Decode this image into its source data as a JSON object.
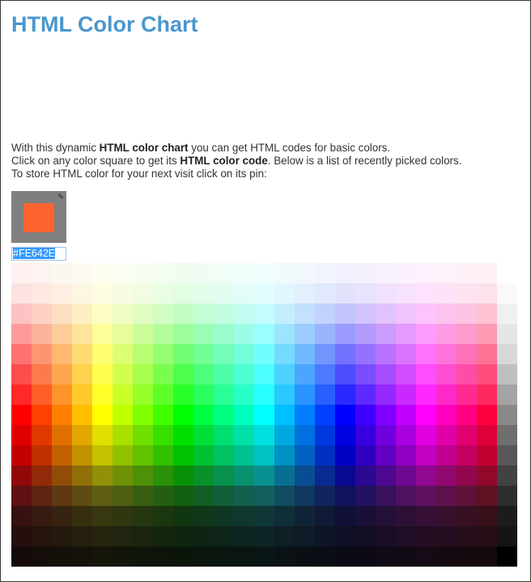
{
  "page": {
    "title": "HTML Color Chart",
    "intro": {
      "line1_pre": "With this dynamic ",
      "line1_bold": "HTML color chart",
      "line1_post": " you can get HTML codes for basic colors.",
      "line2_pre": "Click on any color square to get its ",
      "line2_bold": "HTML color code",
      "line2_post": ". Below is a list of recently picked colors.",
      "line3": "To store HTML color for your next visit click on its pin:"
    }
  },
  "picked": {
    "color": "#FE642E",
    "hex_value": "#FE642E",
    "pin_icon": "pin-icon",
    "background": "#7f7f7f"
  },
  "chart_data": {
    "type": "table",
    "hue_steps": 24,
    "gray_column": [
      "#ffffff",
      "#f9f9f9",
      "#f0f0f0",
      "#e6e6e6",
      "#d8d8d8",
      "#bfbfbf",
      "#a4a4a4",
      "#8a8a8a",
      "#6f6f6f",
      "#585858",
      "#424242",
      "#2e2e2e",
      "#1c1c1c",
      "#151515",
      "#000000"
    ],
    "lightness_rows": [
      0.97,
      0.94,
      0.88,
      0.8,
      0.72,
      0.65,
      0.58,
      0.5,
      0.44,
      0.38,
      0.3,
      0.22,
      0.14,
      0.1,
      0.06
    ],
    "saturation_rows": [
      0.8,
      0.9,
      0.95,
      0.97,
      0.98,
      0.99,
      1.0,
      1.0,
      1.0,
      1.0,
      0.9,
      0.7,
      0.55,
      0.45,
      0.35
    ]
  }
}
